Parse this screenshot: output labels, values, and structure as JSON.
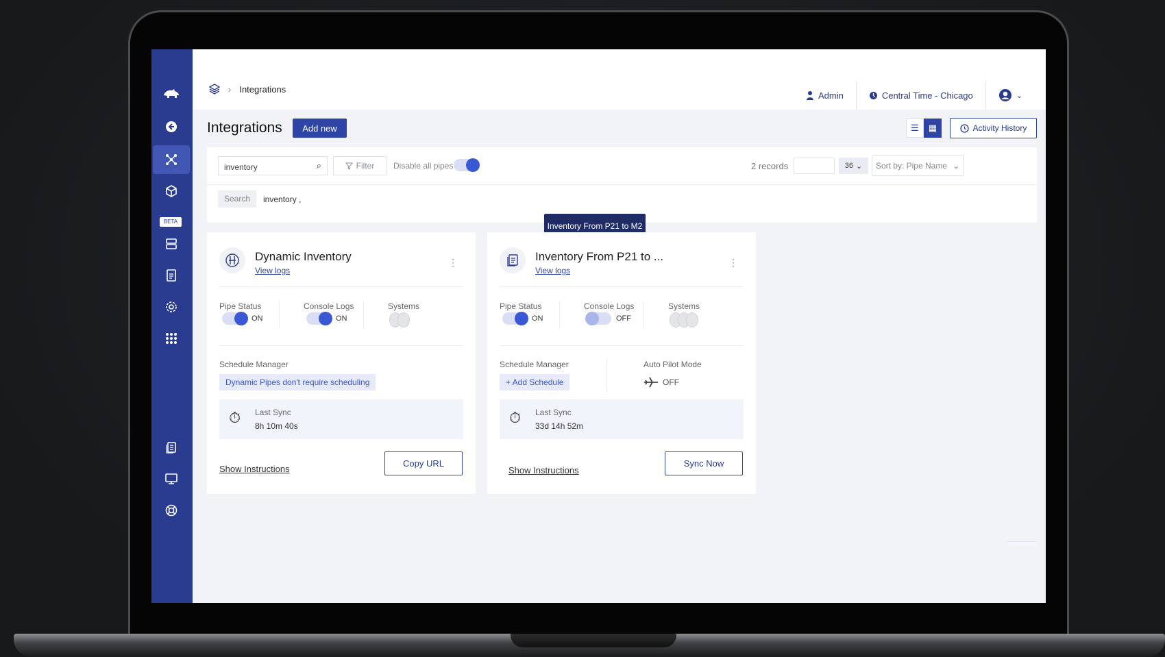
{
  "breadcrumb": {
    "current": "Integrations"
  },
  "topbar": {
    "user_label": "Admin",
    "timezone_label": "Central Time - Chicago"
  },
  "header": {
    "title": "Integrations",
    "add_button": "Add new",
    "activity_history": "Activity History"
  },
  "filters": {
    "search_value": "inventory",
    "filter_label": "Filter",
    "disable_pipes_label": "Disable all pipes",
    "disable_pipes_on": true,
    "records_label": "2 records",
    "per_page": "36",
    "sort_label": "Sort by: Pipe Name",
    "search_tag": "Search",
    "search_term": "inventory ,"
  },
  "tooltip": "Inventory From P21 to M2",
  "cards": [
    {
      "title": "Dynamic Inventory",
      "view_logs": "View logs",
      "pipe_status_label": "Pipe Status",
      "pipe_status": "ON",
      "console_logs_label": "Console Logs",
      "console_logs": "ON",
      "systems_label": "Systems",
      "schedule_label": "Schedule Manager",
      "schedule_tag": "Dynamic Pipes don't require scheduling",
      "last_sync_label": "Last Sync",
      "last_sync_value": "8h 10m 40s",
      "show_instructions": "Show Instructions",
      "action_button": "Copy URL"
    },
    {
      "title": "Inventory From P21 to ...",
      "view_logs": "View logs",
      "pipe_status_label": "Pipe Status",
      "pipe_status": "ON",
      "console_logs_label": "Console Logs",
      "console_logs": "OFF",
      "systems_label": "Systems",
      "schedule_label": "Schedule Manager",
      "schedule_tag": "+ Add Schedule",
      "autopilot_label": "Auto Pilot Mode",
      "autopilot_value": "OFF",
      "last_sync_label": "Last Sync",
      "last_sync_value": "33d 14h 52m",
      "show_instructions": "Show Instructions",
      "action_button": "Sync Now"
    }
  ],
  "sidebar": {
    "beta_label": "BETA"
  }
}
